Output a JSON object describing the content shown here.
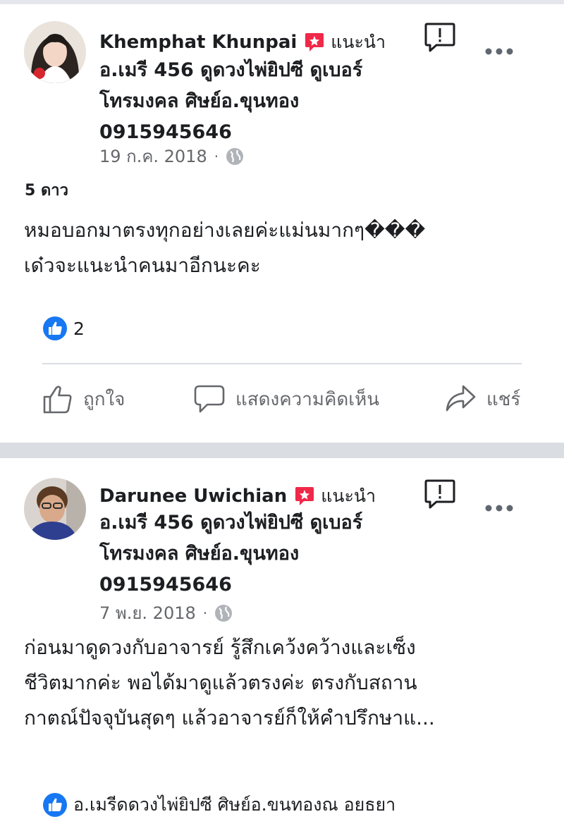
{
  "posts": [
    {
      "author": "Khemphat Khunpai",
      "recommend_label": "แนะนำ",
      "page_lines": [
        "อ.เมรี 456 ดูดวงไพ่ยิปซี ดูเบอร์",
        "โทรมงคล ศิษย์อ.ขุนทอง",
        "0915945646"
      ],
      "date": "19 ก.ค. 2018",
      "rating": "5 ดาว",
      "text_lines": [
        "หมอบอกมาตรงทุกอย่างเลยค่ะแม่นมากๆ���",
        "เด๋วจะแนะนำคนมาอีกนะคะ"
      ],
      "like_count": "2",
      "actions": {
        "like": "ถูกใจ",
        "comment": "แสดงความคิดเห็น",
        "share": "แชร์"
      }
    },
    {
      "author": "Darunee Uwichian",
      "recommend_label": "แนะนำ",
      "page_lines": [
        "อ.เมรี 456 ดูดวงไพ่ยิปซี ดูเบอร์",
        "โทรมงคล ศิษย์อ.ขุนทอง",
        "0915945646"
      ],
      "date": "7 พ.ย. 2018",
      "text_lines": [
        "ก่อนมาดูดวงกับอาจารย์ รู้สึกเคว้งคว้างและเซ็ง",
        "ชีวิตมากค่ะ พอได้มาดูแล้วตรงค่ะ ตรงกับสถาน",
        "กาตณ์ปัจจุบันสุดๆ แล้วอาจารย์ก็ให้คำปรึกษาแ..."
      ],
      "liker_text": "อ.เมรีดดวงไพ่ยิปซี ศิษย์อ.ขนทองณ อยธยา"
    }
  ],
  "colors": {
    "accent": "#1877f2",
    "recommend": "#f02849",
    "muted": "#65676b",
    "text": "#1c1e21"
  }
}
